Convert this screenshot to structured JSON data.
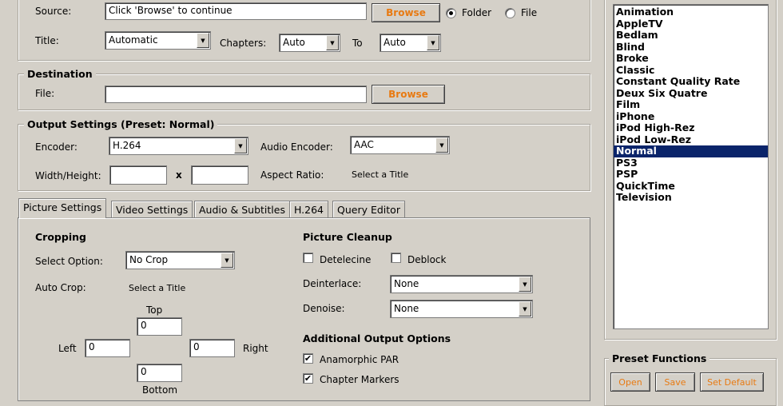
{
  "source": {
    "label": "Source:",
    "value": "Click 'Browse' to continue",
    "browse_label": "Browse",
    "folder_label": "Folder",
    "file_label": "File",
    "title_label": "Title:",
    "title_value": "Automatic",
    "chapters_label": "Chapters:",
    "chapters_start": "Auto",
    "to_label": "To",
    "chapters_end": "Auto"
  },
  "destination": {
    "legend": "Destination",
    "file_label": "File:",
    "file_value": "",
    "browse_label": "Browse"
  },
  "output": {
    "legend": "Output Settings (Preset: Normal)",
    "encoder_label": "Encoder:",
    "encoder_value": "H.264",
    "audio_encoder_label": "Audio Encoder:",
    "audio_encoder_value": "AAC",
    "wh_label": "Width/Height:",
    "width_value": "",
    "x_label": "x",
    "height_value": "",
    "aspect_label": "Aspect Ratio:",
    "aspect_value": "Select a Title"
  },
  "tabs": [
    {
      "label": "Picture Settings"
    },
    {
      "label": "Video Settings"
    },
    {
      "label": "Audio & Subtitles"
    },
    {
      "label": "H.264"
    },
    {
      "label": "Query Editor"
    }
  ],
  "cropping": {
    "heading": "Cropping",
    "select_label": "Select Option:",
    "select_value": "No Crop",
    "auto_label": "Auto Crop:",
    "auto_value": "Select a Title",
    "top_label": "Top",
    "top_value": "0",
    "left_label": "Left",
    "left_value": "0",
    "right_label": "Right",
    "right_value": "0",
    "bottom_label": "Bottom",
    "bottom_value": "0"
  },
  "cleanup": {
    "heading": "Picture Cleanup",
    "detelecine_label": "Detelecine",
    "deblock_label": "Deblock",
    "deinterlace_label": "Deinterlace:",
    "deinterlace_value": "None",
    "denoise_label": "Denoise:",
    "denoise_value": "None"
  },
  "additional": {
    "heading": "Additional Output Options",
    "anamorphic_label": "Anamorphic PAR",
    "anamorphic_check": "✔",
    "chapter_label": "Chapter Markers",
    "chapter_check": "✔"
  },
  "presets": {
    "items": [
      "Animation",
      "AppleTV",
      "Bedlam",
      "Blind",
      "Broke",
      "Classic",
      "Constant Quality Rate",
      "Deux Six Quatre",
      "Film",
      "iPhone",
      "iPod High-Rez",
      "iPod Low-Rez",
      "Normal",
      "PS3",
      "PSP",
      "QuickTime",
      "Television"
    ],
    "selected": "Normal"
  },
  "preset_functions": {
    "legend": "Preset Functions",
    "open_label": "Open",
    "save_label": "Save",
    "default_label": "Set Default"
  },
  "colors": {
    "accent": "#e87a12",
    "selection": "#0a246a",
    "window": "#d4d0c8"
  }
}
